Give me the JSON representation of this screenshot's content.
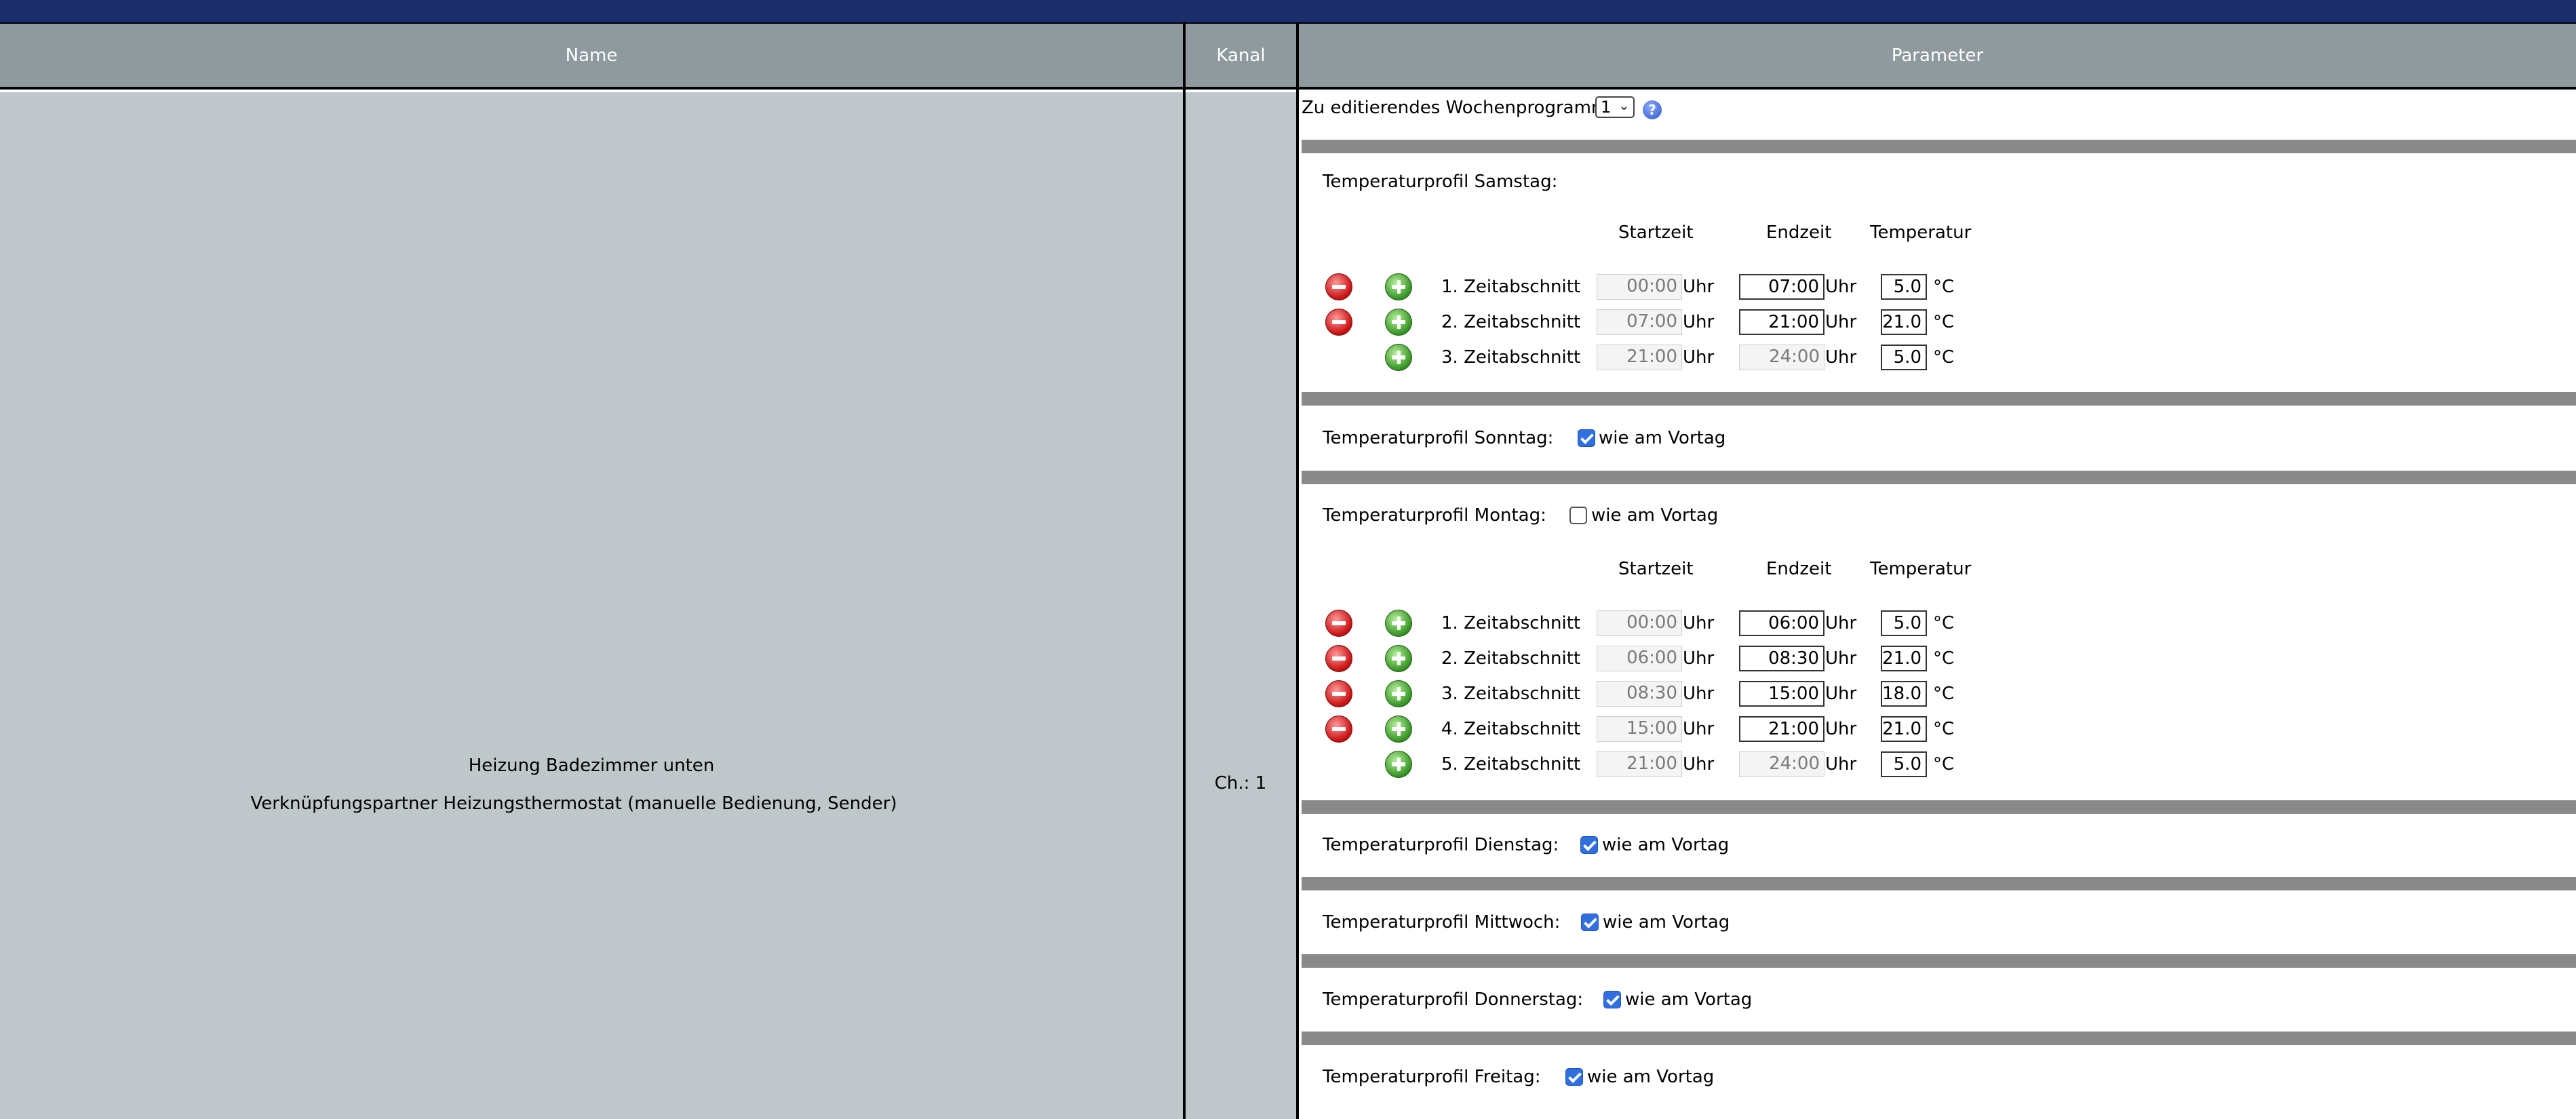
{
  "header": {
    "name_label": "Name",
    "kanal_label": "Kanal",
    "parameter_label": "Parameter"
  },
  "device": {
    "name": "Heizung Badezimmer unten",
    "description": "Verknüpfungspartner Heizungsthermostat (manuelle Bedienung, Sender)",
    "channel": "Ch.: 1"
  },
  "program": {
    "label": "Zu editierendes Wochenprogramm:",
    "selected": "1",
    "help_icon": "help-icon"
  },
  "columns": {
    "start": "Startzeit",
    "end": "Endzeit",
    "temp": "Temperatur"
  },
  "units": {
    "time": "Uhr",
    "temp": "°C"
  },
  "labels": {
    "same_as_prev": "wie am Vortag"
  },
  "days": {
    "samstag": {
      "title": "Temperaturprofil Samstag:",
      "rows": [
        {
          "label": "1. Zeitabschnitt",
          "start": "00:00",
          "end": "07:00",
          "temp": "5.0"
        },
        {
          "label": "2. Zeitabschnitt",
          "start": "07:00",
          "end": "21:00",
          "temp": "21.0"
        },
        {
          "label": "3. Zeitabschnitt",
          "start": "21:00",
          "end": "24:00",
          "temp": "5.0"
        }
      ]
    },
    "sonntag": {
      "title": "Temperaturprofil Sonntag:",
      "same_as_prev": true
    },
    "montag": {
      "title": "Temperaturprofil Montag:",
      "same_as_prev": false,
      "rows": [
        {
          "label": "1. Zeitabschnitt",
          "start": "00:00",
          "end": "06:00",
          "temp": "5.0"
        },
        {
          "label": "2. Zeitabschnitt",
          "start": "06:00",
          "end": "08:30",
          "temp": "21.0"
        },
        {
          "label": "3. Zeitabschnitt",
          "start": "08:30",
          "end": "15:00",
          "temp": "18.0"
        },
        {
          "label": "4. Zeitabschnitt",
          "start": "15:00",
          "end": "21:00",
          "temp": "21.0"
        },
        {
          "label": "5. Zeitabschnitt",
          "start": "21:00",
          "end": "24:00",
          "temp": "5.0"
        }
      ]
    },
    "dienstag": {
      "title": "Temperaturprofil Dienstag:",
      "same_as_prev": true
    },
    "mittwoch": {
      "title": "Temperaturprofil Mittwoch:",
      "same_as_prev": true
    },
    "donnerstag": {
      "title": "Temperaturprofil Donnerstag:",
      "same_as_prev": true
    },
    "freitag": {
      "title": "Temperaturprofil Freitag:",
      "same_as_prev": true
    }
  },
  "colors": {
    "topbar": "#1c2e6b",
    "header": "#8e9a9e",
    "name_bg": "#bfc7ca",
    "separator": "#8a8a8a"
  }
}
